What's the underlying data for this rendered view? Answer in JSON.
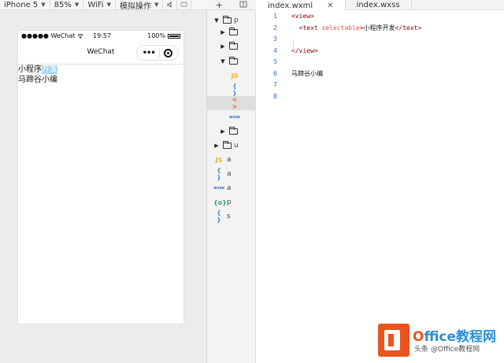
{
  "simulator": {
    "toolbar": {
      "device": "iPhone 5",
      "zoom": "85%",
      "network": "WiFi",
      "operation": "模拟操作",
      "icons": [
        "speaker-icon",
        "screen-icon"
      ]
    },
    "status_bar": {
      "carrier": "●●●●● WeChat",
      "time": "19:57",
      "battery": "100%"
    },
    "nav_bar": {
      "title": "WeChat",
      "menu_icon": "ellipsis-icon",
      "close_icon": "target-circle-icon"
    },
    "page_content": {
      "line1_plain": "小程序",
      "line1_selected": "开发",
      "line2": "马蹄谷小编"
    }
  },
  "file_tree": {
    "header_icons": [
      "add-icon",
      "split-icon"
    ],
    "rows": [
      {
        "kind": "folder-open",
        "expand": "▼",
        "label": "p"
      },
      {
        "kind": "folder",
        "expand": "▶",
        "label": ""
      },
      {
        "kind": "folder",
        "expand": "▶",
        "label": ""
      },
      {
        "kind": "folder-open",
        "expand": "▼",
        "label": ""
      },
      {
        "kind": "js",
        "icon_text": "JS",
        "label": ""
      },
      {
        "kind": "json",
        "icon_text": "{ }",
        "label": ""
      },
      {
        "kind": "wxml",
        "icon_text": "< >",
        "label": "",
        "active": true
      },
      {
        "kind": "wxss",
        "icon_text": "wxss",
        "label": ""
      },
      {
        "kind": "folder",
        "expand": "▶",
        "label": ""
      },
      {
        "kind": "folder",
        "expand": "▶",
        "label": "u"
      },
      {
        "kind": "js",
        "icon_text": "JS",
        "label": "a"
      },
      {
        "kind": "json",
        "icon_text": "{ }",
        "label": "a"
      },
      {
        "kind": "wxss",
        "icon_text": "wxss",
        "label": "a"
      },
      {
        "kind": "cfg",
        "icon_text": "{o}",
        "label": "p"
      },
      {
        "kind": "json",
        "icon_text": "{ }",
        "label": "s"
      }
    ]
  },
  "editor": {
    "tabs": [
      {
        "label": "index.wxml",
        "active": true,
        "close": "✕"
      },
      {
        "label": "index.wxss",
        "active": false
      }
    ],
    "line_numbers": [
      "1",
      "2",
      "3",
      "4",
      "5",
      "6",
      "7",
      "8"
    ],
    "code": {
      "l1_open": "<view>",
      "l2_indent": "  ",
      "l2_tag_open": "<text ",
      "l2_attr": "selectable",
      "l2_tag_close": ">",
      "l2_text": "小程序开发",
      "l2_end": "</text>",
      "l4_close": "</view>",
      "l6_text": "马蹄谷小编"
    }
  },
  "watermark": {
    "title_o": "O",
    "title_rest": "ffice教程网",
    "subtitle": "头条 @Office教程网",
    "brand_color": "#e8531e",
    "accent_color": "#2c8fd4"
  }
}
